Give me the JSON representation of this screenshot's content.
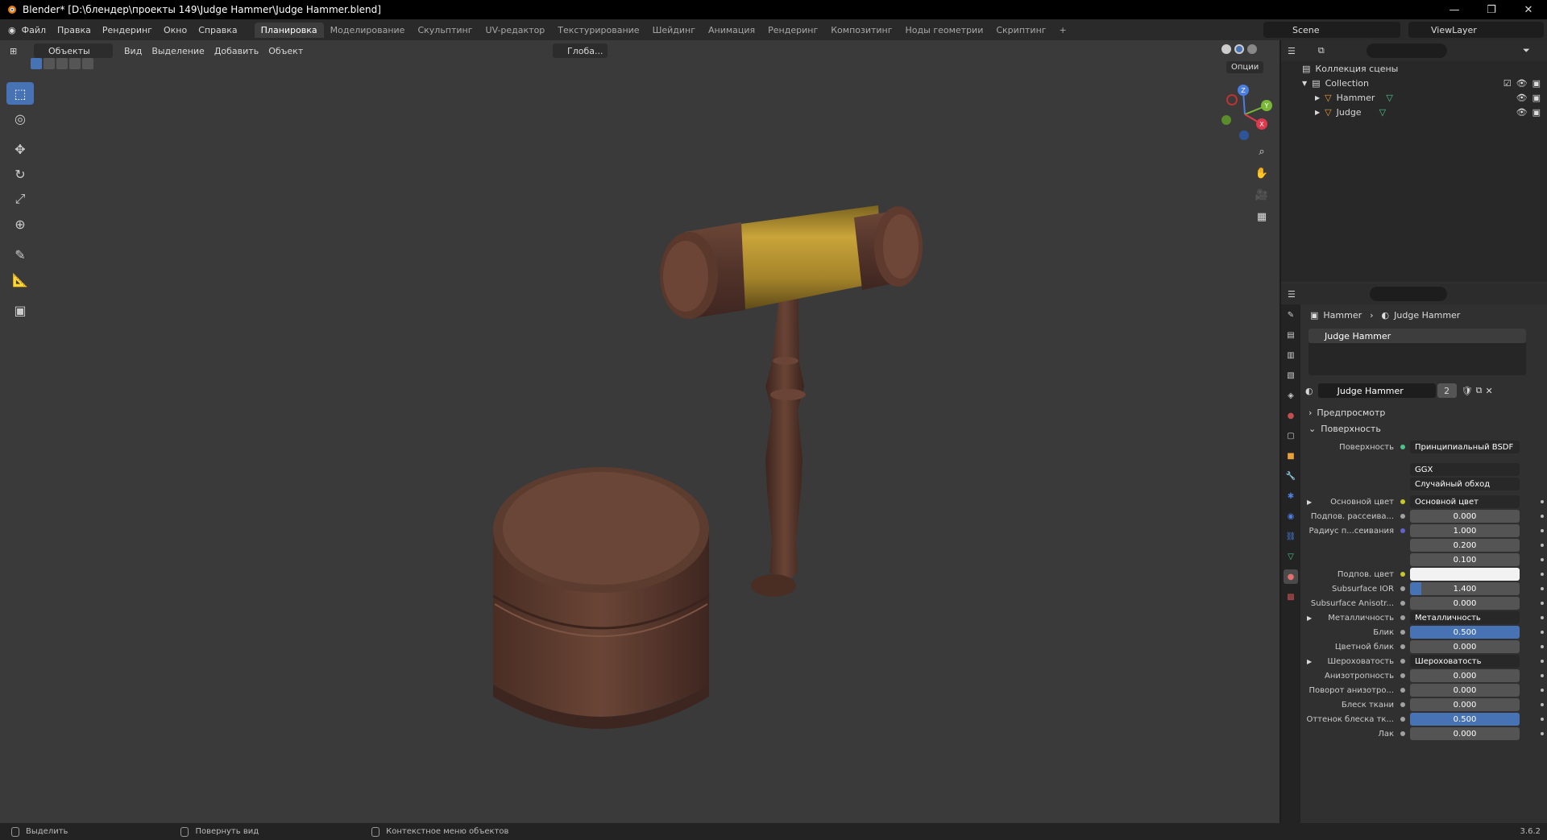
{
  "window": {
    "title": "Blender* [D:\\блендер\\проекты 149\\Judge Hammer\\Judge Hammer.blend]",
    "controls": [
      "—",
      "❐",
      "✕"
    ]
  },
  "menu": [
    "Файл",
    "Правка",
    "Рендеринг",
    "Окно",
    "Справка"
  ],
  "workspaces": [
    {
      "label": "Планировка",
      "active": true
    },
    {
      "label": "Моделирование"
    },
    {
      "label": "Скульптинг"
    },
    {
      "label": "UV-редактор"
    },
    {
      "label": "Текстурирование"
    },
    {
      "label": "Шейдинг"
    },
    {
      "label": "Анимация"
    },
    {
      "label": "Рендеринг"
    },
    {
      "label": "Композитинг"
    },
    {
      "label": "Ноды геометрии"
    },
    {
      "label": "Скриптинг"
    },
    {
      "label": "+"
    }
  ],
  "scene": "Scene",
  "view_layer": "ViewLayer",
  "viewport": {
    "mode": "Объекты",
    "menu": [
      "Вид",
      "Выделение",
      "Добавить",
      "Объект"
    ],
    "transform_orientation": "Глоба...",
    "options": "Опции"
  },
  "tools": [
    {
      "name": "select-box-tool",
      "glyph": "⬚",
      "active": true
    },
    {
      "name": "cursor-tool",
      "glyph": "◎"
    },
    {
      "name": "move-tool",
      "glyph": "✥"
    },
    {
      "name": "rotate-tool",
      "glyph": "↻"
    },
    {
      "name": "scale-tool",
      "glyph": "⤢"
    },
    {
      "name": "transform-tool",
      "glyph": "⊕"
    },
    {
      "name": "annotate-tool",
      "glyph": "✎"
    },
    {
      "name": "measure-tool",
      "glyph": "📐"
    },
    {
      "name": "add-cube-tool",
      "glyph": "▣"
    }
  ],
  "gizmo_axes": [
    "Z",
    "Y",
    "X"
  ],
  "outliner": {
    "root": "Коллекция сцены",
    "collection": "Collection",
    "objects": [
      "Hammer",
      "Judge"
    ]
  },
  "properties": {
    "breadcrumb_object": "Hammer",
    "breadcrumb_material": "Judge Hammer",
    "slot": "Judge Hammer",
    "material_name": "Judge Hammer",
    "users": "2",
    "panels": {
      "preview": "Предпросмотр",
      "surface": "Поверхность"
    },
    "surface_label": "Поверхность",
    "surface_value": "Принципиальный BSDF",
    "distribution": "GGX",
    "subsurface_method": "Случайный обход",
    "rows": [
      {
        "label": "Основной цвет",
        "value": "Основной цвет",
        "type": "link",
        "socket": "#c7c729",
        "expand": true
      },
      {
        "label": "Подпов. рассеива...",
        "value": "0.000",
        "type": "num",
        "socket": "#a1a1a1",
        "fill": 0
      },
      {
        "label": "Радиус п...сеивания",
        "value": "1.000",
        "type": "num",
        "socket": "#6363c7",
        "fill": 0
      },
      {
        "label": "",
        "value": "0.200",
        "type": "num",
        "socket": "",
        "fill": 0
      },
      {
        "label": "",
        "value": "0.100",
        "type": "num",
        "socket": "",
        "fill": 0
      },
      {
        "label": "Подпов. цвет",
        "value": "",
        "type": "color",
        "socket": "#c7c729"
      },
      {
        "label": "Subsurface IOR",
        "value": "1.400",
        "type": "num",
        "socket": "#a1a1a1",
        "fill": 0.1
      },
      {
        "label": "Subsurface Anisotr...",
        "value": "0.000",
        "type": "num",
        "socket": "#a1a1a1",
        "fill": 0
      },
      {
        "label": "Металличность",
        "value": "Металличность",
        "type": "link",
        "socket": "#a1a1a1",
        "expand": true
      },
      {
        "label": "Блик",
        "value": "0.500",
        "type": "num",
        "socket": "#a1a1a1",
        "fill": 1
      },
      {
        "label": "Цветной блик",
        "value": "0.000",
        "type": "num",
        "socket": "#a1a1a1",
        "fill": 0
      },
      {
        "label": "Шероховатость",
        "value": "Шероховатость",
        "type": "link",
        "socket": "#a1a1a1",
        "expand": true
      },
      {
        "label": "Анизотропность",
        "value": "0.000",
        "type": "num",
        "socket": "#a1a1a1",
        "fill": 0
      },
      {
        "label": "Поворот анизотро...",
        "value": "0.000",
        "type": "num",
        "socket": "#a1a1a1",
        "fill": 0
      },
      {
        "label": "Блеск ткани",
        "value": "0.000",
        "type": "num",
        "socket": "#a1a1a1",
        "fill": 0
      },
      {
        "label": "Оттенок блеска тк...",
        "value": "0.500",
        "type": "num",
        "socket": "#a1a1a1",
        "fill": 1
      },
      {
        "label": "Лак",
        "value": "0.000",
        "type": "num",
        "socket": "#a1a1a1",
        "fill": 0
      }
    ]
  },
  "status": {
    "left": "Выделить",
    "middle": "Повернуть вид",
    "right": "Контекстное меню объектов",
    "version": "3.6.2"
  },
  "colors": {
    "accent": "#4772b3",
    "wood": "#5a3a2e",
    "brass": "#b8962a"
  }
}
